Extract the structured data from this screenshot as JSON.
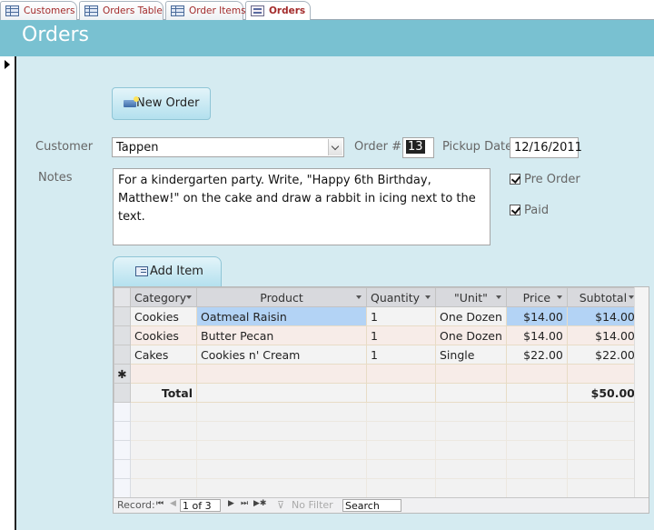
{
  "tabs": [
    {
      "label": "Customers",
      "icon": "table-icon"
    },
    {
      "label": "Orders Table",
      "icon": "table-icon"
    },
    {
      "label": "Order Items",
      "icon": "table-icon"
    },
    {
      "label": "Orders",
      "icon": "form-icon",
      "active": true
    }
  ],
  "header": {
    "title": "Orders"
  },
  "form": {
    "new_order_label": "New Order",
    "customer_label": "Customer",
    "customer_value": "Tappen",
    "order_no_label": "Order #",
    "order_no_value": "13",
    "pickup_label": "Pickup Date",
    "pickup_value": "12/16/2011",
    "notes_label": "Notes",
    "notes_value": "For a kindergarten party. Write, \"Happy 6th Birthday, Matthew!\" on the cake and draw a rabbit in icing next to the text.",
    "pre_order_label": "Pre Order",
    "pre_order_checked": true,
    "paid_label": "Paid",
    "paid_checked": true,
    "add_item_label": "Add Item"
  },
  "grid": {
    "columns": [
      "Category",
      "Product",
      "Quantity",
      "\"Unit\"",
      "Price",
      "Subtotal"
    ],
    "rows": [
      {
        "category": "Cookies",
        "product": "Oatmeal Raisin",
        "quantity": "1",
        "unit": "One Dozen",
        "price": "$14.00",
        "subtotal": "$14.00"
      },
      {
        "category": "Cookies",
        "product": "Butter Pecan",
        "quantity": "1",
        "unit": "One Dozen",
        "price": "$14.00",
        "subtotal": "$14.00"
      },
      {
        "category": "Cakes",
        "product": "Cookies n' Cream",
        "quantity": "1",
        "unit": "Single",
        "price": "$22.00",
        "subtotal": "$22.00"
      }
    ],
    "new_row_marker": "✱",
    "total_label": "Total",
    "total_value": "$50.00"
  },
  "navigation": {
    "record_label": "Record:",
    "record_value": "1 of 3",
    "filter_label": "No Filter",
    "search_placeholder": "Search"
  }
}
